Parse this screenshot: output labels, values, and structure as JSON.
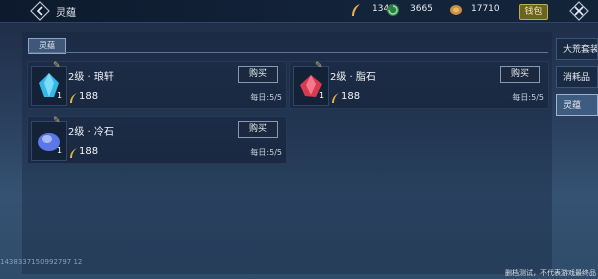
{
  "header": {
    "title": "灵蕴",
    "resources": [
      {
        "name": "feather-currency",
        "value": "1345",
        "color": "#e2b349"
      },
      {
        "name": "green-swirl-currency",
        "value": "3665",
        "color": "#3aa35a"
      },
      {
        "name": "gold-coin-currency",
        "value": "17710",
        "color": "#c98e43"
      }
    ],
    "wallet_label": "钱包"
  },
  "section_tab": "灵蕴",
  "items": [
    {
      "name": "2级 · 琅轩",
      "qty": "1",
      "price": "188",
      "limit": "每日:5/5",
      "buy_label": "购买",
      "gem_color": "#34b8e6"
    },
    {
      "name": "2级 · 脂石",
      "qty": "1",
      "price": "188",
      "limit": "每日:5/5",
      "buy_label": "购买",
      "gem_color": "#d83a52"
    },
    {
      "name": "2级 · 冷石",
      "qty": "1",
      "price": "188",
      "limit": "每日:5/5",
      "buy_label": "购买",
      "gem_color": "#5a78e8"
    }
  ],
  "side_tabs": [
    {
      "label": "大荒套装",
      "active": false
    },
    {
      "label": "消耗品",
      "active": false
    },
    {
      "label": "灵蕴",
      "active": true
    }
  ],
  "footer": {
    "id": "1438337150992797 12",
    "note": "删档测试，不代表游戏最终品"
  }
}
